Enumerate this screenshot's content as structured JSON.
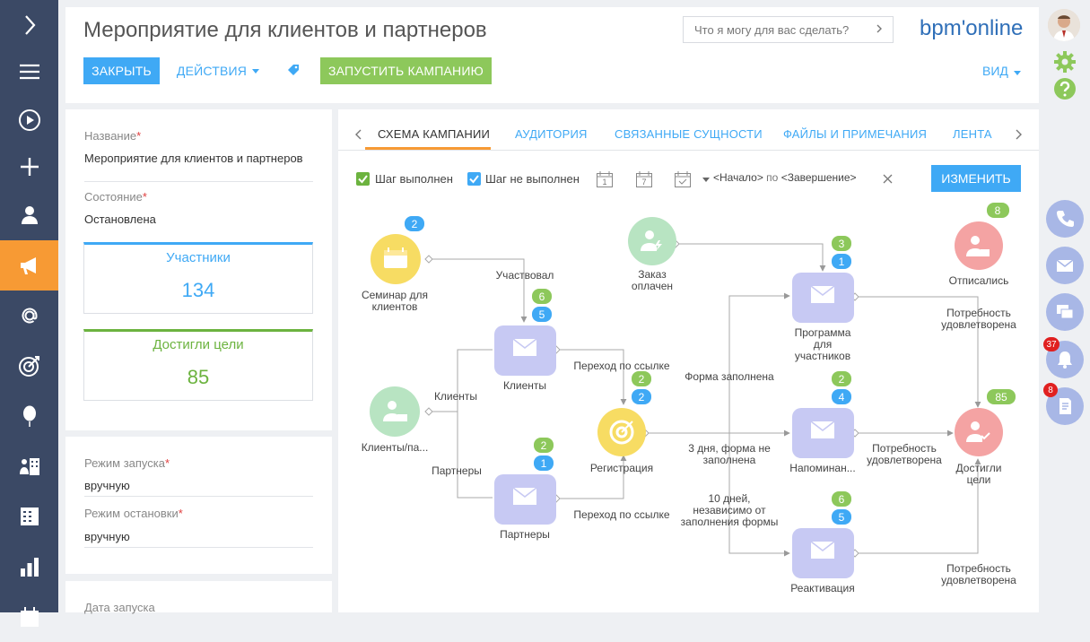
{
  "nav": {
    "items": [
      "expand",
      "menu",
      "play",
      "add",
      "contacts",
      "campaigns",
      "email",
      "goal",
      "balloon",
      "accounts",
      "documents",
      "analytics",
      "calendar"
    ]
  },
  "header": {
    "title": "Мероприятие для клиентов и партнеров",
    "close_label": "ЗАКРЫТЬ",
    "actions_label": "ДЕЙСТВИЯ",
    "launch_label": "ЗАПУСТИТЬ КАМПАНИЮ",
    "search_placeholder": "Что я могу для вас сделать?",
    "brand": "bpm'online",
    "view_label": "ВИД"
  },
  "sidebar_right": {
    "notifications_count": "37",
    "tasks_count": "8"
  },
  "info": {
    "name_label": "Название",
    "name_value": "Мероприятие для клиентов и партнеров",
    "state_label": "Состояние",
    "state_value": "Остановлена",
    "participants_label": "Участники",
    "participants_value": "134",
    "goal_label": "Достигли цели",
    "goal_value": "85"
  },
  "launch": {
    "mode_label": "Режим запуска",
    "mode_value": "вручную",
    "stop_label": "Режим остановки",
    "stop_value": "вручную",
    "date_label": "Дата запуска"
  },
  "tabs": [
    "СХЕМА КАМПАНИИ",
    "АУДИТОРИЯ",
    "СВЯЗАННЫЕ СУЩНОСТИ",
    "ФАЙЛЫ И ПРИМЕЧАНИЯ",
    "ЛЕНТА"
  ],
  "toolbar": {
    "step_done": "Шаг выполнен",
    "step_not_done": "Шаг не выполнен",
    "cal_1": "1",
    "cal_7": "7",
    "range_start": "<Начало>",
    "range_by": "по",
    "range_end": "<Завершение>",
    "edit_label": "ИЗМЕНИТЬ"
  },
  "diagram": {
    "nodes": {
      "seminar": {
        "label1": "Семинар для",
        "label2": "клиентов",
        "count": "2"
      },
      "order": {
        "label1": "Заказ",
        "label2": "оплачен"
      },
      "unsub": {
        "label": "Отписались",
        "count": "8"
      },
      "clients_list": {
        "label": "Клиенты/па..."
      },
      "clients_mail": {
        "label": "Клиенты",
        "done": "6",
        "notdone": "5"
      },
      "partners_mail": {
        "label": "Партнеры",
        "done": "2",
        "notdone": "1"
      },
      "registration": {
        "label": "Регистрация",
        "done": "2",
        "notdone": "2"
      },
      "program": {
        "label1": "Программа",
        "label2": "для",
        "label3": "участников",
        "done": "3",
        "notdone": "1"
      },
      "reminder": {
        "label": "Напоминан...",
        "done": "2",
        "notdone": "4"
      },
      "reactivation": {
        "label": "Реактивация",
        "done": "6",
        "notdone": "5"
      },
      "goal": {
        "label1": "Достигли",
        "label2": "цели",
        "count": "85"
      }
    },
    "edges": {
      "participated": "Участвовал",
      "clients": "Клиенты",
      "partners": "Партнеры",
      "link1": "Переход по ссылке",
      "link2": "Переход по ссылке",
      "form_filled": "Форма заполнена",
      "three_days_1": "3 дня, форма не",
      "three_days_2": "заполнена",
      "ten_days_1": "10 дней,",
      "ten_days_2": "независимо от",
      "ten_days_3": "заполнения формы",
      "need1_1": "Потребность",
      "need1_2": "удовлетворена",
      "need2_1": "Потребность",
      "need2_2": "удовлетворена",
      "need3_1": "Потребность",
      "need3_2": "удовлетворена"
    }
  },
  "colors": {
    "nav_bg": "#3b4965",
    "accent_orange": "#f79a34",
    "accent_blue": "#3fa9f5",
    "accent_green": "#8dc85b",
    "email_node": "#c7c9f3",
    "goal_node": "#f4a3a3",
    "event_node": "#f7dc63",
    "audience_node": "#b8e4c2"
  }
}
